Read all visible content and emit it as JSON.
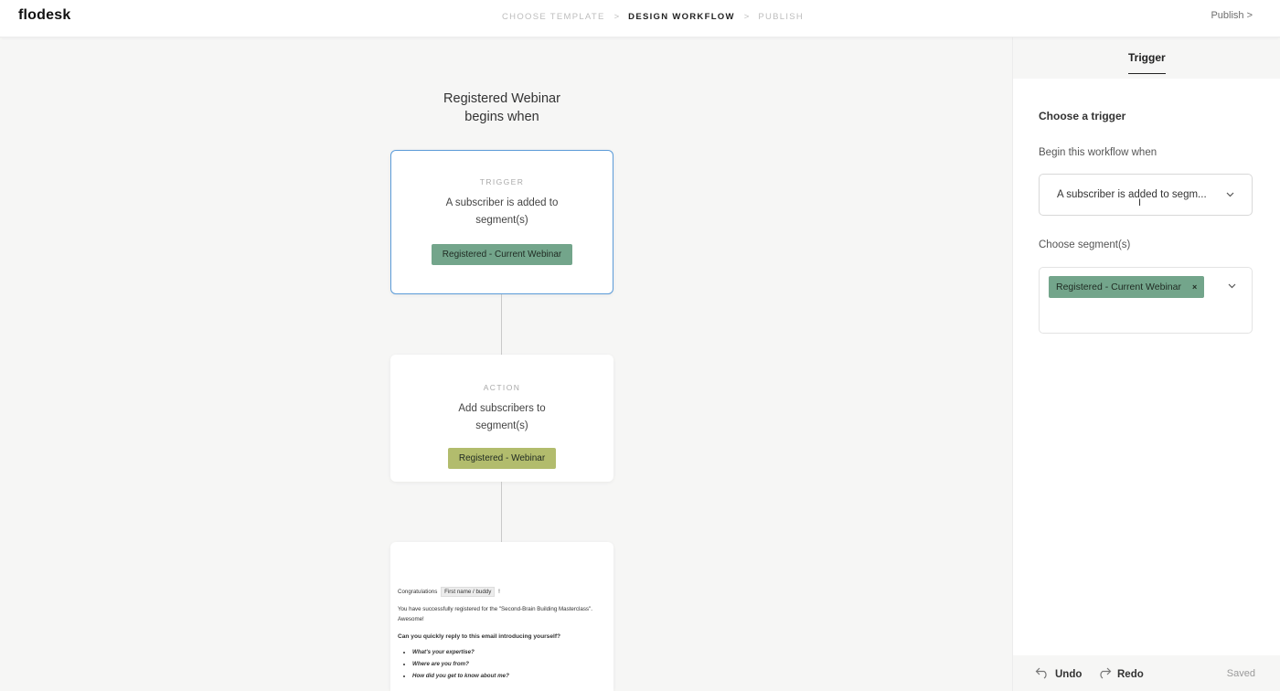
{
  "app": {
    "logo": "flodesk"
  },
  "header": {
    "steps": [
      {
        "label": "CHOOSE TEMPLATE"
      },
      {
        "label": "DESIGN WORKFLOW"
      },
      {
        "label": "PUBLISH"
      }
    ],
    "separator": ">",
    "publish_label": "Publish >"
  },
  "canvas": {
    "title_line1": "Registered Webinar",
    "title_line2": "begins when",
    "trigger_card": {
      "kicker": "TRIGGER",
      "description": "A subscriber is added to segment(s)",
      "segment": "Registered - Current Webinar"
    },
    "action_card": {
      "kicker": "ACTION",
      "description": "Add subscribers to segment(s)",
      "segment": "Registered - Webinar"
    },
    "email_card": {
      "greeting": "Congratulations",
      "name_chip": "First name / buddy",
      "greeting_end": "!",
      "body": "You have successfully registered for the \"Second-Brain Building Masterclass\". Awesome!",
      "question": "Can you quickly reply to this email introducing yourself?",
      "bullets": [
        "What's your expertise?",
        "Where are you from?",
        "How did you get to know about me?"
      ]
    }
  },
  "panel": {
    "tab_label": "Trigger",
    "section_title": "Choose a trigger",
    "begin_label": "Begin this workflow when",
    "trigger_select_value": "A subscriber is added to segm...",
    "segment_label": "Choose segment(s)",
    "selected_segment": "Registered - Current Webinar",
    "remove_glyph": "×",
    "footer": {
      "undo_label": "Undo",
      "redo_label": "Redo",
      "saved_label": "Saved"
    }
  },
  "colors": {
    "trigger_border": "#5b9bd8",
    "segment_green": "#73a58b",
    "segment_olive": "#b2bc6d"
  }
}
